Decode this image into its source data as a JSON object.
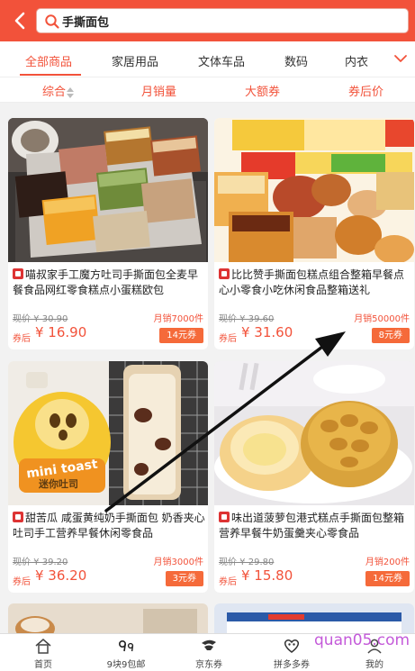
{
  "search": {
    "query": "手撕面包"
  },
  "categories": [
    "全部商品",
    "家居用品",
    "文体车品",
    "数码",
    "内衣"
  ],
  "sorts": [
    "综合",
    "月销量",
    "大额券",
    "券后价"
  ],
  "products": [
    {
      "title": "喵叔家手工魔方吐司手撕面包全麦早餐食品网红零食糕点小蛋糕欧包",
      "orig_price": "现价 ¥ 30.90",
      "monthly_sales": "月销7000件",
      "after_label": "券后",
      "after_price": "¥ 16.90",
      "coupon": "14元券"
    },
    {
      "title": "比比赞手撕面包糕点组合整箱早餐点心小零食小吃休闲食品整箱送礼",
      "orig_price": "现价 ¥ 39.60",
      "monthly_sales": "月销50000件",
      "after_label": "券后",
      "after_price": "¥ 31.60",
      "coupon": "8元券"
    },
    {
      "title": "甜苦瓜 咸蛋黄纯奶手撕面包 奶香夹心吐司手工营养早餐休闲零食品",
      "orig_price": "现价 ¥ 39.20",
      "monthly_sales": "月销3000件",
      "after_label": "券后",
      "after_price": "¥ 36.20",
      "coupon": "3元券"
    },
    {
      "title": "味出道菠萝包港式糕点手撕面包整箱营养早餐牛奶蛋羹夹心零食品",
      "orig_price": "现价 ¥ 29.80",
      "monthly_sales": "月销200件",
      "after_label": "券后",
      "after_price": "¥ 15.80",
      "coupon": "14元券"
    }
  ],
  "image_text": {
    "mini_toast": "mini toast",
    "brand_cn": "迷你吐司"
  },
  "bottom_nav": [
    {
      "label": "首页",
      "icon": "home-icon"
    },
    {
      "label": "9块9包邮",
      "icon": "nine-nine-icon"
    },
    {
      "label": "京东券",
      "icon": "jd-icon"
    },
    {
      "label": "拼多多券",
      "icon": "pdd-icon"
    },
    {
      "label": "我的",
      "icon": "user-icon"
    }
  ],
  "watermark": "quan05.com",
  "colors": {
    "accent": "#f2523a",
    "coupon": "#f56a3a",
    "annotation_arrow": "#000000"
  }
}
